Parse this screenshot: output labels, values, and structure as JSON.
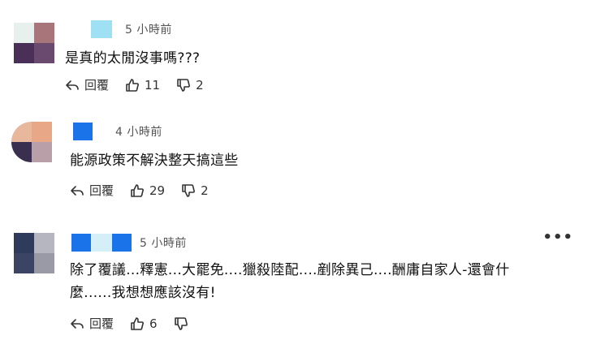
{
  "comments": [
    {
      "time": "5 小時前",
      "text": "是真的太閒沒事嗎???",
      "reply_label": "回覆",
      "likes": "11",
      "dislikes": "2"
    },
    {
      "time": "4 小時前",
      "text": "能源政策不解決整天搞這些",
      "reply_label": "回覆",
      "likes": "29",
      "dislikes": "2"
    },
    {
      "time": "5 小時前",
      "text_line1": "除了覆議...釋憲...大罷免....獵殺陸配....剷除異己....酬庸自家人-還會什",
      "text_line2": "麼......我想想應該沒有!",
      "reply_label": "回覆",
      "likes": "6",
      "dislikes": ""
    }
  ],
  "more_label": "•••",
  "colors": {
    "accent_blue": "#1a73e8",
    "text": "#111111",
    "muted": "#555555"
  }
}
